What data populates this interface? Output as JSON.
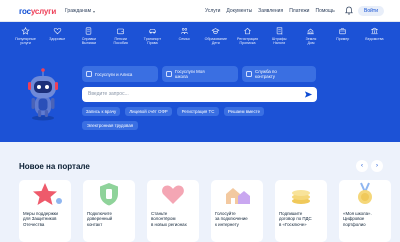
{
  "header": {
    "logo_left": "гос",
    "logo_right": "услуги",
    "region": "Гражданам",
    "nav": [
      "Услуги",
      "Документы",
      "Заявления",
      "Платежи",
      "Помощь"
    ],
    "login_label": "Войти"
  },
  "categories": [
    {
      "label": "Популярные\nуслуги",
      "icon": "star-icon"
    },
    {
      "label": "Здоровье",
      "icon": "heart-icon"
    },
    {
      "label": "Справки\nВыписки",
      "icon": "document-icon"
    },
    {
      "label": "Пенсии\nПособия",
      "icon": "wallet-icon"
    },
    {
      "label": "Транспорт\nПрава",
      "icon": "car-icon"
    },
    {
      "label": "Семья",
      "icon": "family-icon"
    },
    {
      "label": "Образование\nДети",
      "icon": "graduation-icon"
    },
    {
      "label": "Регистрация\nПрописка",
      "icon": "home-icon"
    },
    {
      "label": "Штрафы\nНалоги",
      "icon": "receipt-icon"
    },
    {
      "label": "Земля\nДом",
      "icon": "land-icon"
    },
    {
      "label": "Пример",
      "icon": "box-icon"
    },
    {
      "label": "Ведомства",
      "icon": "building-icon"
    }
  ],
  "suggestions": [
    "Госуслуги и Алиса",
    "Госуслуги Моя\nшкола",
    "Служба по\nконтракту"
  ],
  "search": {
    "placeholder": "Введите запрос..."
  },
  "chips": [
    "Запись к врачу",
    "Лицевой счёт ОФР",
    "Регистрация ТС",
    "Решаем вместе",
    "Электронная трудовая"
  ],
  "news": {
    "title": "Новое на портале",
    "cards": [
      "Меры поддержки\nдля Защитников\nОтечества",
      "Подключите\nдоверенный\nконтакт",
      "Станьте\nволонтёром\nв новых регионах",
      "Голосуйте\nза подключение\nк интернету",
      "Подпишите\nдоговор по ПДС\nв «Госключе»",
      "«Моя школа».\nЦифровое\nпортфолио"
    ]
  },
  "colors": {
    "brand_blue": "#1c52d6",
    "logo_blue": "#0d4cd3",
    "logo_red": "#ee3f58",
    "page_bg": "#edf2fb"
  }
}
